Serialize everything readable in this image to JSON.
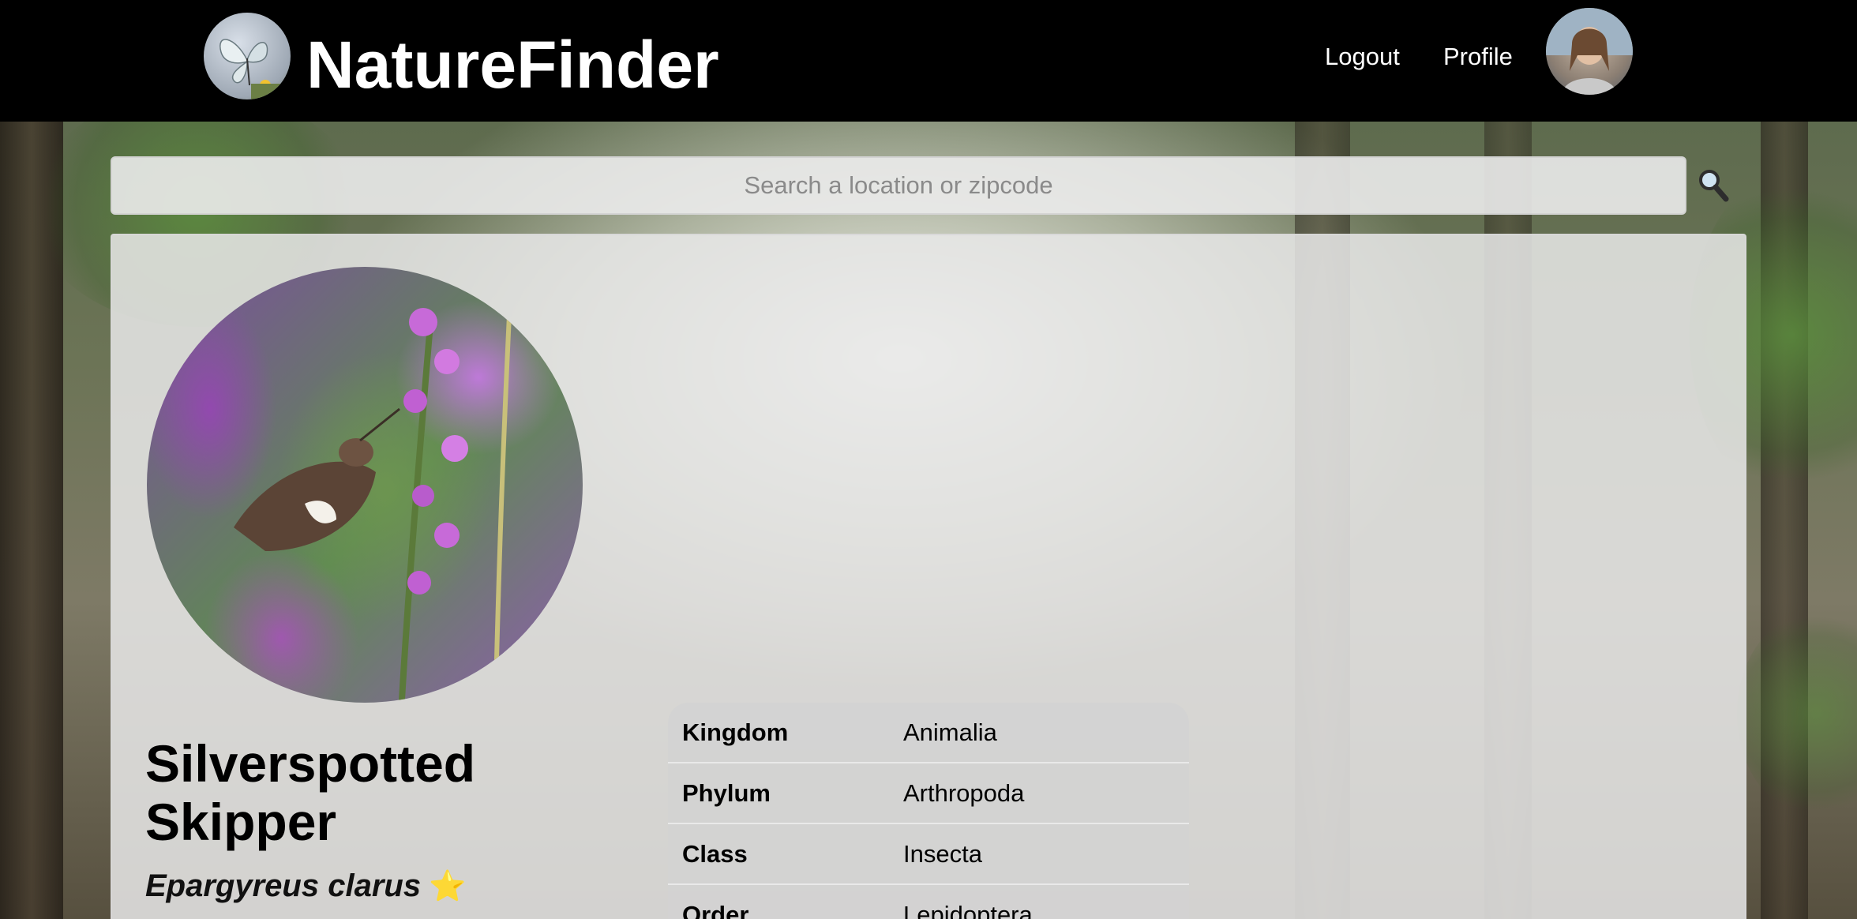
{
  "header": {
    "app_title": "NatureFinder",
    "logo_icon": "butterfly-logo-icon",
    "nav": {
      "logout_label": "Logout",
      "profile_label": "Profile"
    },
    "avatar_icon": "user-avatar"
  },
  "search": {
    "placeholder": "Search a location or zipcode",
    "value": "",
    "button_icon": "magnifying-glass-icon",
    "button_glyph": "🔍"
  },
  "species": {
    "common_name": "Silverspotted Skipper",
    "scientific_name": "Epargyreus clarus",
    "favorite_glyph": "⭐",
    "photo_icon": "species-photo"
  },
  "taxonomy": [
    {
      "label": "Kingdom",
      "value": "Animalia"
    },
    {
      "label": "Phylum",
      "value": "Arthropoda"
    },
    {
      "label": "Class",
      "value": "Insecta"
    },
    {
      "label": "Order",
      "value": "Lepidoptera"
    }
  ],
  "colors": {
    "header_bg": "#000000",
    "card_bg": "#e8e8e8",
    "star": "#f5c518"
  }
}
